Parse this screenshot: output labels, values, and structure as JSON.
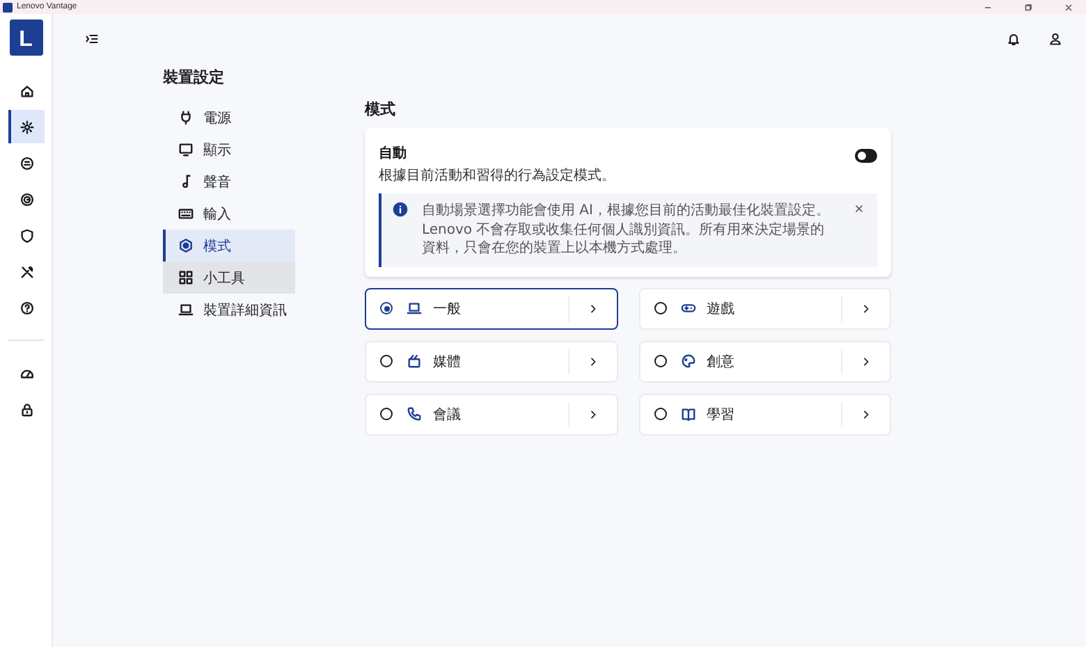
{
  "window": {
    "title": "Lenovo Vantage"
  },
  "app_logo": "L",
  "rail": {
    "top": [
      {
        "selected": false
      },
      {
        "selected": true
      },
      {
        "selected": false
      },
      {
        "selected": false
      },
      {
        "selected": false
      },
      {
        "selected": false
      },
      {
        "selected": false
      }
    ],
    "bottom": [
      {
        "selected": false
      },
      {
        "selected": false
      }
    ]
  },
  "nav": {
    "title": "裝置設定",
    "items": [
      {
        "label": "電源",
        "selected": false,
        "hovered": false
      },
      {
        "label": "顯示",
        "selected": false,
        "hovered": false
      },
      {
        "label": "聲音",
        "selected": false,
        "hovered": false
      },
      {
        "label": "輸入",
        "selected": false,
        "hovered": false
      },
      {
        "label": "模式",
        "selected": true,
        "hovered": false
      },
      {
        "label": "小工具",
        "selected": false,
        "hovered": true
      },
      {
        "label": "裝置詳細資訊",
        "selected": false,
        "hovered": false
      }
    ]
  },
  "section": {
    "title": "模式",
    "auto": {
      "title": "自動",
      "description": "根據目前活動和習得的行為設定模式。",
      "on": false,
      "info": "自動場景選擇功能會使用 AI，根據您目前的活動最佳化裝置設定。Lenovo 不會存取或收集任何個人識別資訊。所有用來決定場景的資料，只會在您的裝置上以本機方式處理。"
    },
    "modes": [
      {
        "label": "一般",
        "selected": true
      },
      {
        "label": "遊戲",
        "selected": false
      },
      {
        "label": "媒體",
        "selected": false
      },
      {
        "label": "創意",
        "selected": false
      },
      {
        "label": "會議",
        "selected": false
      },
      {
        "label": "學習",
        "selected": false
      }
    ]
  }
}
